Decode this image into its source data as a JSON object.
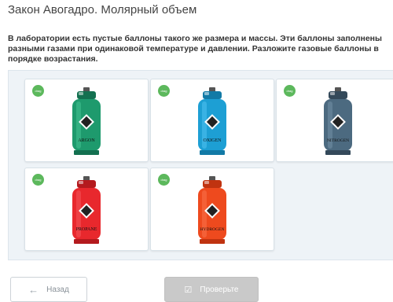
{
  "page": {
    "title": "Закон Авогадро. Молярный объем"
  },
  "task": {
    "question": "В лаборатории есть пустые баллоны такого же размера и массы. Эти баллоны заполнены разными газами при одинаковой температуре и давлении. Разложите газовые баллоны в порядке возрастания."
  },
  "cylinders": [
    {
      "label": "ARGON",
      "badge": "drag",
      "color": "#1e9a6d",
      "dark": "#137050",
      "light": "#3fc090"
    },
    {
      "label": "OXIGEN",
      "badge": "drag",
      "color": "#1d9fd4",
      "dark": "#127aa6",
      "light": "#4cc0ee"
    },
    {
      "label": "NITROGEN",
      "badge": "drag",
      "color": "#4c6a80",
      "dark": "#34495a",
      "light": "#6f8da3"
    },
    {
      "label": "PROPANE",
      "badge": "drag",
      "color": "#e8282d",
      "dark": "#b41a1e",
      "light": "#f25055"
    },
    {
      "label": "HYDROGEN",
      "badge": "drag",
      "color": "#ee4a1e",
      "dark": "#c03310",
      "light": "#f87048"
    }
  ],
  "buttons": {
    "back": "Назад",
    "check": "Проверьте",
    "back_icon": "arrow-left-icon",
    "check_icon": "checkbox-icon"
  }
}
